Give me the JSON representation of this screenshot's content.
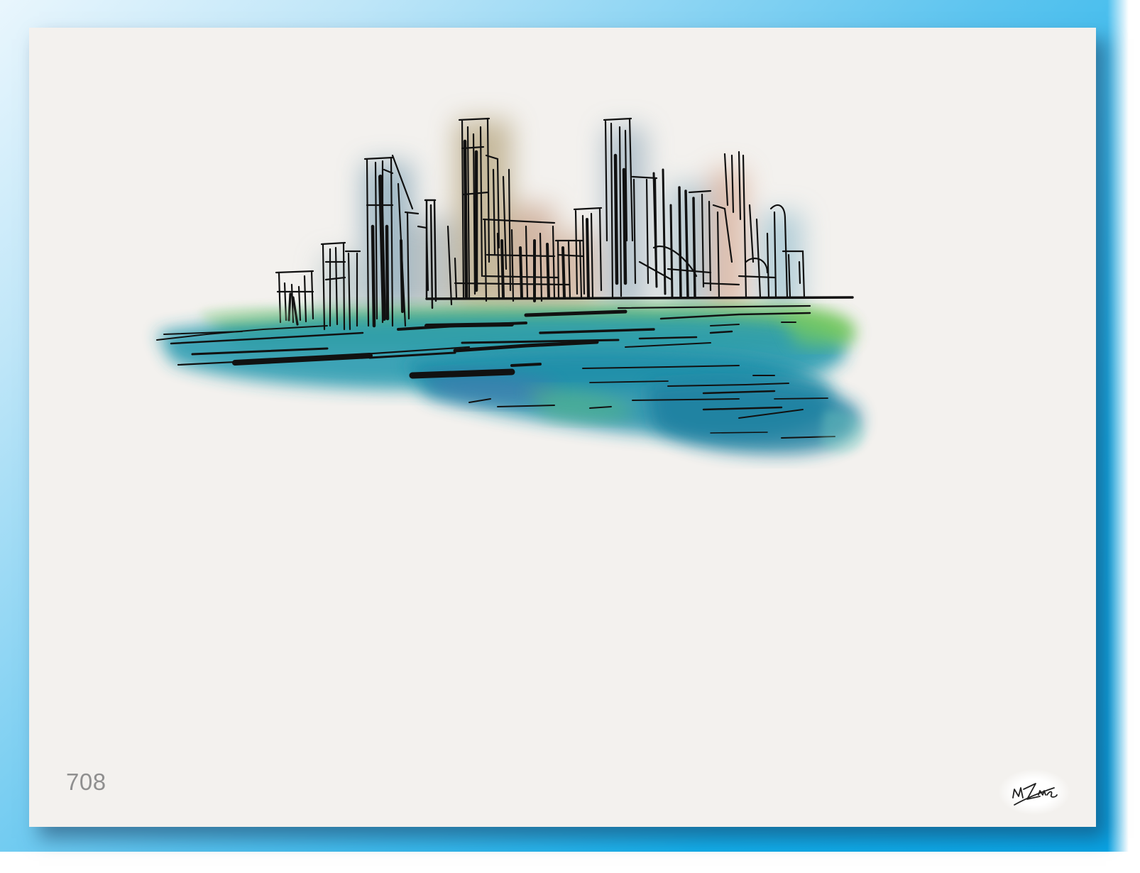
{
  "page": {
    "number": "708"
  },
  "artwork": {
    "subject_icon": "city-skyline-sketch-icon",
    "signature_icon": "artist-signature-icon",
    "signature_text": "MLZ"
  },
  "colors": {
    "background_gradient_start": "#e9f6fd",
    "background_gradient_end": "#08a3e4",
    "paper": "#f3f1ee",
    "water_teal": "#1f8fa6",
    "water_green": "#5dbd4a",
    "ink": "#111111",
    "page_number": "#8f8f8f"
  }
}
